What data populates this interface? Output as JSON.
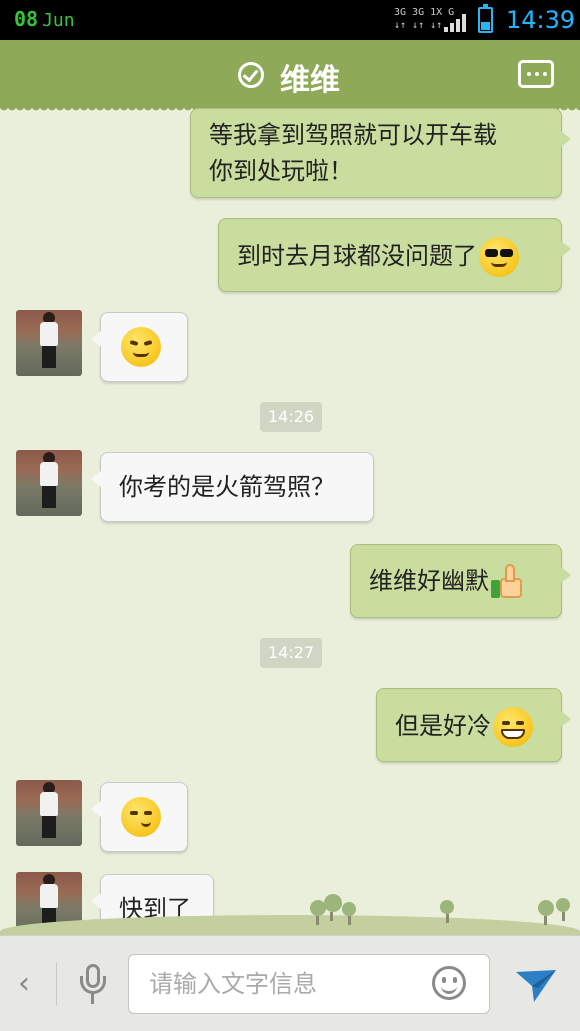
{
  "status_bar": {
    "date_day": "08",
    "date_month": "Jun",
    "network_line1": "3G 3G 1X G",
    "network_line2": "↓↑ ↓↑ ↓↑",
    "time": "14:39",
    "battery_level": 0.35
  },
  "header": {
    "title": "维维",
    "check_icon": "check-circle-icon",
    "menu_icon": "more-icon"
  },
  "messages": [
    {
      "side": "out",
      "text": "等我拿到驾照就可以开车载",
      "text2": "你到处玩啦！"
    },
    {
      "side": "out",
      "text": "到时去月球都没问题了",
      "emoji": "cool-sunglasses-emoji"
    },
    {
      "side": "in",
      "emoji": "annoyed-emoji"
    },
    {
      "type": "timestamp",
      "text": "14:26"
    },
    {
      "side": "in",
      "text": "你考的是火箭驾照？"
    },
    {
      "side": "out",
      "text": "维维好幽默",
      "emoji": "thumbs-up-emoji"
    },
    {
      "type": "timestamp",
      "text": "14:27"
    },
    {
      "side": "out",
      "text": "但是好冷",
      "emoji": "grin-emoji"
    },
    {
      "side": "in",
      "emoji": "shy-emoji"
    },
    {
      "side": "in",
      "text": "快到了"
    }
  ],
  "input": {
    "placeholder": "请输入文字信息",
    "back_icon": "chevron-left-icon",
    "voice_icon": "microphone-icon",
    "emoji_icon": "smiley-icon",
    "send_icon": "send-icon"
  },
  "colors": {
    "header_green": "#8ea957",
    "outgoing_bubble": "#c9dd9f",
    "incoming_bubble": "#f7f7f7",
    "chat_background": "#e9efda"
  }
}
